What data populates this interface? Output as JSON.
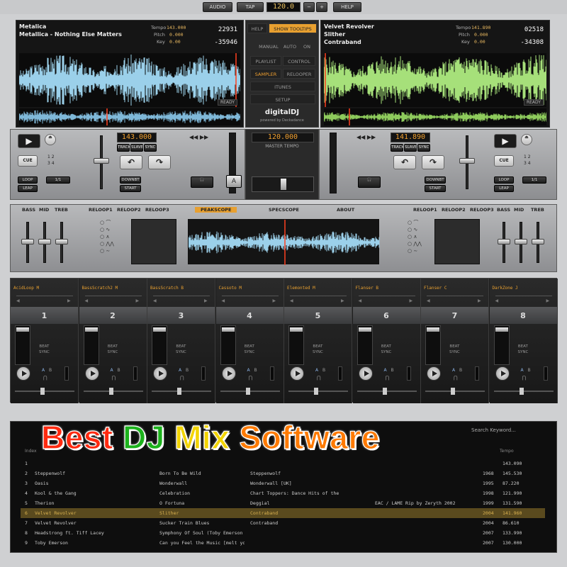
{
  "topbar": {
    "audio": "AUDIO",
    "tap": "TAP",
    "tempo": "120.0",
    "minus": "−",
    "plus": "+",
    "help": "HELP"
  },
  "deckA": {
    "artist": "Metalica",
    "title": "Metallica - Nothing Else Matters",
    "tempo_label": "Tempo",
    "pitch_label": "Pitch",
    "key_label": "Key",
    "tempo": "143.000",
    "pitch": "0.000",
    "key": "0.00",
    "time_elapsed": "22931",
    "time_remaining": "-35946",
    "ready": "READY",
    "bpm_lcd": "143.000",
    "play": "▶",
    "cue": "CUE",
    "loop": "LOOP",
    "leap": "LEAP",
    "track": "TRACK",
    "slave": "SLAVE",
    "sync": "SYNC",
    "downbeat": "DOWNBT",
    "start": "START",
    "onebeat": "1/1",
    "opt1": "1",
    "opt2": "2",
    "opt3": "3",
    "opt4": "4"
  },
  "deckB": {
    "artist": "Velvet Revolver",
    "title": "Slither",
    "album": "Contraband",
    "tempo_label": "Tempo",
    "pitch_label": "Pitch",
    "key_label": "Key",
    "tempo": "141.890",
    "pitch": "0.000",
    "key": "0.00",
    "time_elapsed": "02518",
    "time_remaining": "-34308",
    "ready": "READY",
    "bpm_lcd": "141.890",
    "play": "▶",
    "cue": "CUE",
    "loop": "LOOP",
    "leap": "LEAP",
    "track": "TRACK",
    "slave": "SLAVE",
    "sync": "SYNC",
    "downbeat": "DOWNBT",
    "start": "START",
    "onebeat": "1/1",
    "opt1": "1",
    "opt2": "2",
    "opt3": "3",
    "opt4": "4"
  },
  "center": {
    "help": "HELP",
    "show_tooltips": "SHOW TOOLTIPS",
    "manual": "MANUAL",
    "auto": "AUTO",
    "on": "ON",
    "playlist": "PLAYLIST",
    "control": "CONTROL",
    "sampler": "SAMPLER",
    "relooper": "RELOOPER",
    "itunes": "ITUNES",
    "setup": "SETUP",
    "brand": "digitalDJ",
    "brand_sub": "powered by Deckadance",
    "master_bpm": "120.000",
    "master_tempo": "MASTER TEMPO",
    "deck_a": "A",
    "deck_b": "B"
  },
  "fx": {
    "bass": "BASS",
    "mid": "MID",
    "treb": "TREB",
    "reloop1": "RELOOP1",
    "reloop2": "RELOOP2",
    "reloop3": "RELOOP3",
    "peakscope": "PEAKSCOPE",
    "specscope": "SPECSCOPE",
    "about": "ABOUT"
  },
  "samplers": [
    {
      "name": "AcidLoop M",
      "num": "1"
    },
    {
      "name": "BassScratch2 M",
      "num": "2"
    },
    {
      "name": "BassScratch B",
      "num": "3"
    },
    {
      "name": "Cassoto M",
      "num": "4"
    },
    {
      "name": "Elemonted M",
      "num": "5"
    },
    {
      "name": "Flanser B",
      "num": "6"
    },
    {
      "name": "Flanser C",
      "num": "7"
    },
    {
      "name": "DarkZone J",
      "num": "8"
    }
  ],
  "sampler_labels": {
    "beat": "BEAT",
    "sync": "SYNC",
    "a": "A",
    "b": "B"
  },
  "library": {
    "search": "Search Keyword...",
    "col_index": "Index",
    "col_tempo": "Tempo",
    "rows": [
      {
        "idx": "1",
        "artist": "",
        "title": "",
        "album": "",
        "year": "",
        "tempo": "143.090"
      },
      {
        "idx": "2",
        "artist": "Steppenwolf",
        "title": "Born To Be Wild",
        "album": "Steppenwolf",
        "year": "1968",
        "tempo": "145.530"
      },
      {
        "idx": "3",
        "artist": "Oasis",
        "title": "Wonderwall",
        "album": "Wonderwall [UK]",
        "year": "1995",
        "tempo": "87.220"
      },
      {
        "idx": "4",
        "artist": "Kool & the Gang",
        "title": "Celebration",
        "album": "Chart Toppers: Dance Hits of the",
        "year": "1998",
        "tempo": "121.990"
      },
      {
        "idx": "5",
        "artist": "Therion",
        "title": "O Fortuna",
        "album": "Deggial",
        "comment": "EAC / LAME Rip by Zeryth 2002",
        "year": "1999",
        "tempo": "131.590"
      },
      {
        "idx": "6",
        "artist": "Velvet Revolver",
        "title": "Slither",
        "album": "Contraband",
        "year": "2004",
        "tempo": "141.960"
      },
      {
        "idx": "7",
        "artist": "Velvet Revolver",
        "title": "Sucker Train Blues",
        "album": "Contraband",
        "year": "2004",
        "tempo": "86.610"
      },
      {
        "idx": "8",
        "artist": "Headstrong ft. Tiff Lacey",
        "title": "Symphony Of Soul (Toby Emerson",
        "album": "",
        "year": "2007",
        "tempo": "133.990"
      },
      {
        "idx": "9",
        "artist": "Toby Emerson",
        "title": "Can you Feel the Music [melt you",
        "album": "",
        "year": "2007",
        "tempo": "130.000"
      }
    ]
  },
  "overlay": {
    "best": "Best",
    "dj": "DJ",
    "mix": "Mix",
    "software": "Software"
  }
}
